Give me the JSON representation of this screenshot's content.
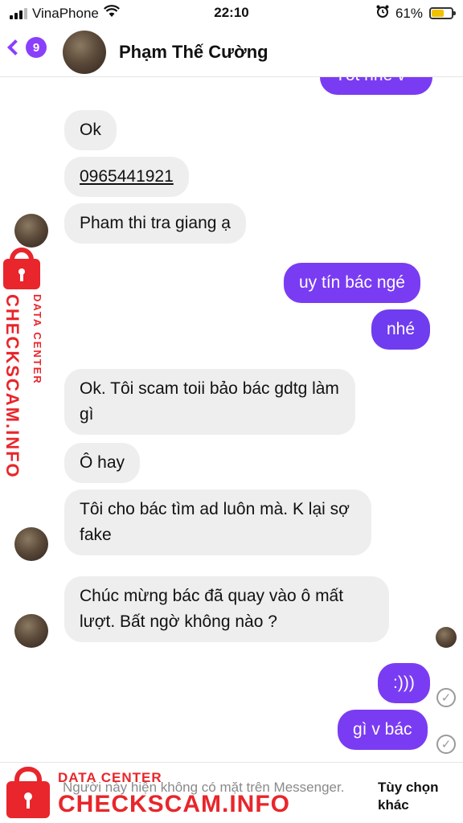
{
  "status_bar": {
    "carrier": "VinaPhone",
    "time": "22:10",
    "battery_percent": "61%",
    "battery_level": 0.61,
    "icons": [
      "signal-icon",
      "wifi-icon",
      "alarm-icon",
      "battery-icon"
    ]
  },
  "header": {
    "back_badge_count": "9",
    "contact_name": "Phạm Thế Cường",
    "top_partial_message": "Tốt nhé v"
  },
  "messages": [
    {
      "side": "in",
      "text": "Ok"
    },
    {
      "side": "in",
      "text": "0965441921"
    },
    {
      "side": "in",
      "text": "Pham thi tra giang ạ"
    },
    {
      "side": "out",
      "text": "uy tín bác ngé"
    },
    {
      "side": "out",
      "text": "nhé"
    },
    {
      "side": "in",
      "text": "Ok. Tôi scam toii bảo bác gdtg làm gì"
    },
    {
      "side": "in",
      "text": "Ô hay"
    },
    {
      "side": "in",
      "text": "Tôi cho bác tìm ad luôn mà. K lại sợ fake"
    },
    {
      "side": "in",
      "text": "Chúc mừng bác đã quay vào ô mất lượt. Bất ngờ không nào ?"
    },
    {
      "side": "out",
      "text": ":)))"
    },
    {
      "side": "out",
      "text": "gì v bác"
    }
  ],
  "footer": {
    "notice": "Người này hiện không có mặt trên Messenger.",
    "options_label": "Tùy chọn khác"
  },
  "watermark": {
    "data_center": "DATA CENTER",
    "brand": "CHECKSCAM.INFO"
  },
  "colors": {
    "accent": "#7a3cf2",
    "incoming_bubble": "#eeeeee",
    "watermark_red": "#e8262b"
  }
}
